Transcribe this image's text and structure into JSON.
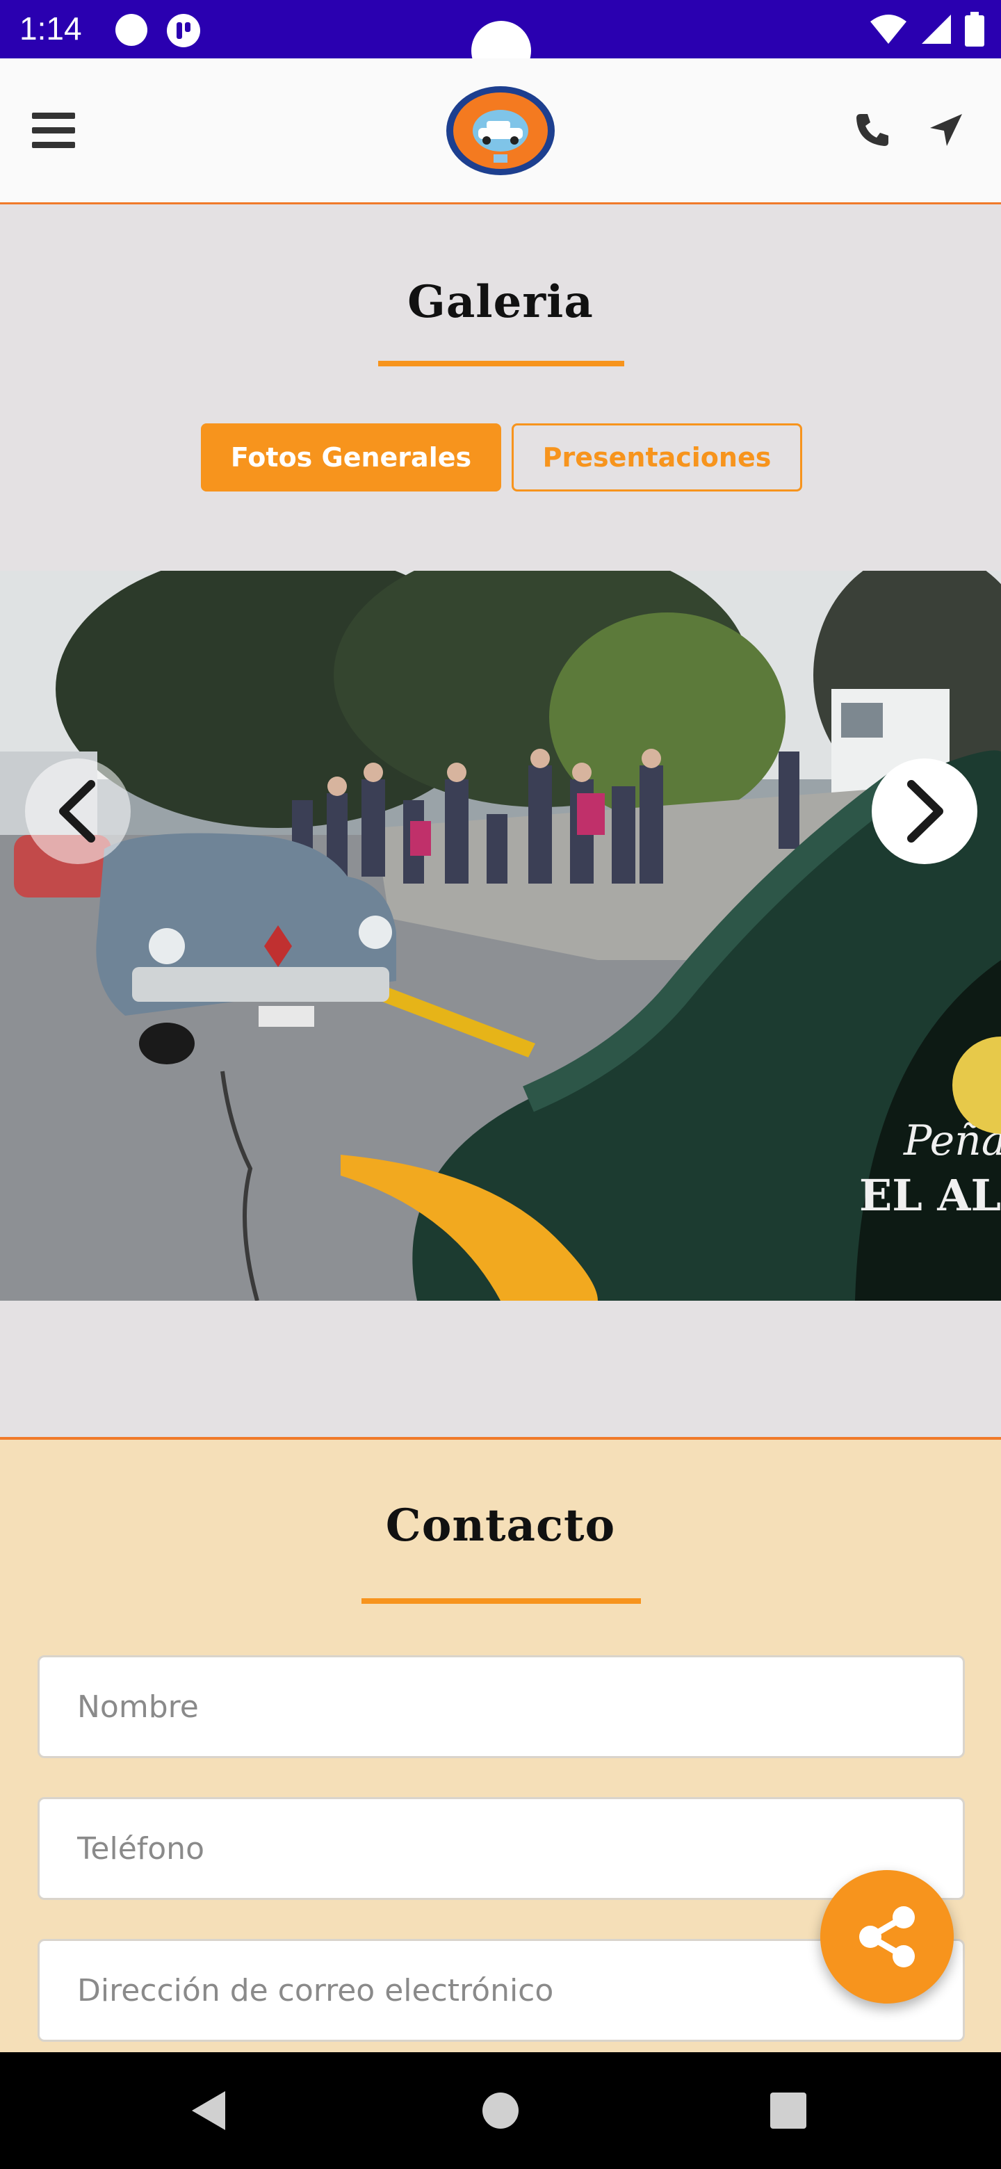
{
  "status_bar": {
    "time": "1:14"
  },
  "header": {
    "logo_alt": "CLUB AUTOS DEL AYER DE CHACABUCO"
  },
  "galeria": {
    "title": "Galeria",
    "tabs": [
      {
        "label": "Fotos Generales",
        "active": true
      },
      {
        "label": "Presentaciones",
        "active": false
      }
    ],
    "carousel": {
      "prev_icon": "chevron-left-icon",
      "next_icon": "chevron-right-icon"
    }
  },
  "contacto": {
    "title": "Contacto",
    "fields": [
      {
        "placeholder": "Nombre",
        "value": ""
      },
      {
        "placeholder": "Teléfono",
        "value": ""
      },
      {
        "placeholder": "Dirección de correo electrónico",
        "value": ""
      }
    ]
  },
  "fab": {
    "icon": "share-icon"
  },
  "colors": {
    "accent": "#f7941d",
    "header_border": "#f07a2a",
    "status_bar": "#2a00b0",
    "contact_bg": "#f5dfb8",
    "gallery_bg": "#e4e1e3"
  }
}
